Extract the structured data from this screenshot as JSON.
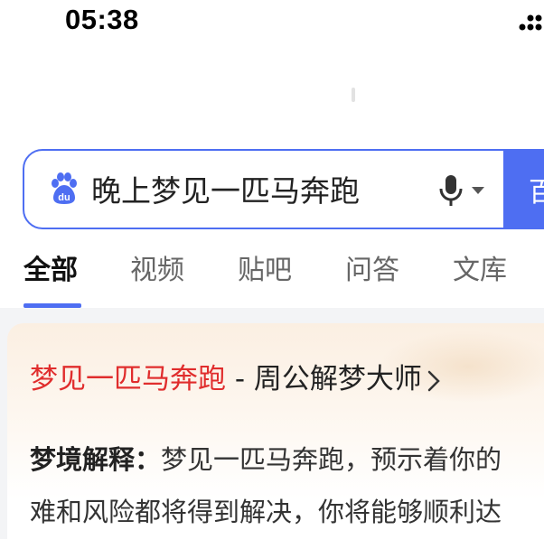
{
  "status_bar": {
    "time": "05:38"
  },
  "search": {
    "query": "晚上梦见一匹马奔跑",
    "button_label": "百度一下"
  },
  "tabs": [
    {
      "label": "全部",
      "active": true
    },
    {
      "label": "视频",
      "active": false
    },
    {
      "label": "贴吧",
      "active": false
    },
    {
      "label": "问答",
      "active": false
    },
    {
      "label": "文库",
      "active": false
    }
  ],
  "result": {
    "title_highlight": "梦见一匹马奔跑",
    "title_rest": " - 周公解梦大师",
    "body_label": "梦境解释：",
    "body_line1": "梦见一匹马奔跑，预示着你的",
    "body_line2": "难和风险都将得到解决，你将能够顺利达"
  },
  "colors": {
    "accent": "#4e6ef2",
    "highlight": "#e02d2d"
  },
  "icons": {
    "paw": "baidu-paw-icon",
    "mic": "microphone-icon",
    "caret": "caret-down-icon",
    "chevron": "chevron-right-icon",
    "signal": "signal-icon"
  }
}
